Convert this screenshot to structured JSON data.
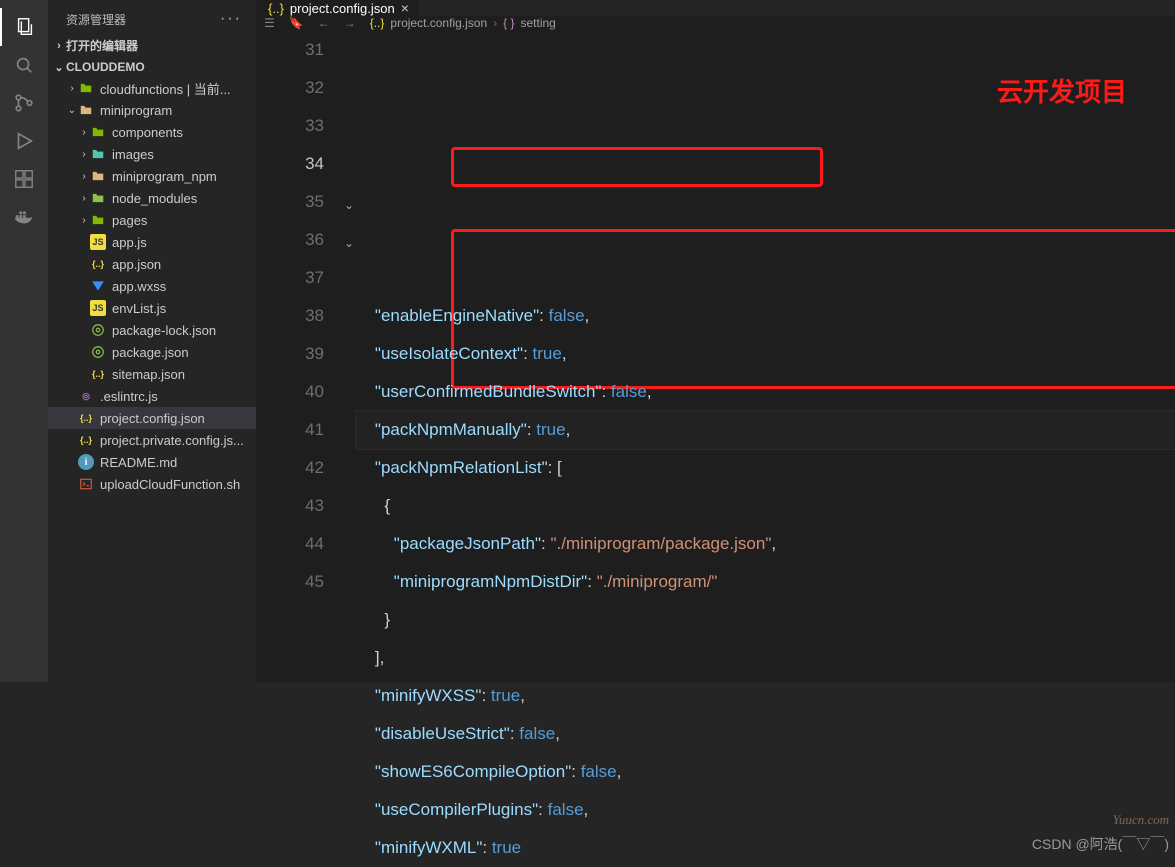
{
  "activity_bar": {
    "items": [
      "files",
      "search",
      "source-control",
      "run-debug",
      "extensions",
      "docker"
    ]
  },
  "sidebar": {
    "title": "资源管理器",
    "sections": {
      "open_editors": "打开的编辑器",
      "project": "CLOUDDEMO"
    },
    "tree": [
      {
        "type": "folder",
        "label": "cloudfunctions | 当前...",
        "indent": 1,
        "expanded": false,
        "icon": "folder-green"
      },
      {
        "type": "folder",
        "label": "miniprogram",
        "indent": 1,
        "expanded": true,
        "icon": "folder"
      },
      {
        "type": "folder",
        "label": "components",
        "indent": 2,
        "expanded": false,
        "icon": "folder-green"
      },
      {
        "type": "folder",
        "label": "images",
        "indent": 2,
        "expanded": false,
        "icon": "folder-teal"
      },
      {
        "type": "folder",
        "label": "miniprogram_npm",
        "indent": 2,
        "expanded": false,
        "icon": "folder"
      },
      {
        "type": "folder",
        "label": "node_modules",
        "indent": 2,
        "expanded": false,
        "icon": "nm"
      },
      {
        "type": "folder",
        "label": "pages",
        "indent": 2,
        "expanded": false,
        "icon": "folder-green"
      },
      {
        "type": "file",
        "label": "app.js",
        "indent": 2,
        "icon": "js"
      },
      {
        "type": "file",
        "label": "app.json",
        "indent": 2,
        "icon": "json"
      },
      {
        "type": "file",
        "label": "app.wxss",
        "indent": 2,
        "icon": "wxss"
      },
      {
        "type": "file",
        "label": "envList.js",
        "indent": 2,
        "icon": "js"
      },
      {
        "type": "file",
        "label": "package-lock.json",
        "indent": 2,
        "icon": "nm"
      },
      {
        "type": "file",
        "label": "package.json",
        "indent": 2,
        "icon": "nm"
      },
      {
        "type": "file",
        "label": "sitemap.json",
        "indent": 2,
        "icon": "json"
      },
      {
        "type": "file",
        "label": ".eslintrc.js",
        "indent": 1,
        "icon": "target"
      },
      {
        "type": "file",
        "label": "project.config.json",
        "indent": 1,
        "icon": "json",
        "selected": true
      },
      {
        "type": "file",
        "label": "project.private.config.js...",
        "indent": 1,
        "icon": "json"
      },
      {
        "type": "file",
        "label": "README.md",
        "indent": 1,
        "icon": "readme"
      },
      {
        "type": "file",
        "label": "uploadCloudFunction.sh",
        "indent": 1,
        "icon": "sh"
      }
    ]
  },
  "tab": {
    "label": "project.config.json"
  },
  "breadcrumb": {
    "file": "project.config.json",
    "symbol": "setting"
  },
  "editor": {
    "line_start": 31,
    "current_line": 34,
    "lines": [
      {
        "num": 31,
        "indent": 2,
        "key": "enableEngineNative",
        "val": "false",
        "comma": true
      },
      {
        "num": 32,
        "indent": 2,
        "key": "useIsolateContext",
        "val": "true",
        "comma": true
      },
      {
        "num": 33,
        "indent": 2,
        "key": "userConfirmedBundleSwitch",
        "val": "false",
        "comma": true
      },
      {
        "num": 34,
        "indent": 2,
        "key": "packNpmManually",
        "val": "true",
        "comma": true
      },
      {
        "num": 35,
        "indent": 2,
        "key": "packNpmRelationList",
        "open": "["
      },
      {
        "num": 36,
        "indent": 3,
        "open": "{"
      },
      {
        "num": 37,
        "indent": 4,
        "key": "packageJsonPath",
        "strval": "./miniprogram/package.json",
        "comma": true
      },
      {
        "num": 38,
        "indent": 4,
        "key": "miniprogramNpmDistDir",
        "strval": "./miniprogram/"
      },
      {
        "num": 39,
        "indent": 3,
        "close": "}"
      },
      {
        "num": 40,
        "indent": 2,
        "close": "]",
        "comma": true
      },
      {
        "num": 41,
        "indent": 2,
        "key": "minifyWXSS",
        "val": "true",
        "comma": true
      },
      {
        "num": 42,
        "indent": 2,
        "key": "disableUseStrict",
        "val": "false",
        "comma": true
      },
      {
        "num": 43,
        "indent": 2,
        "key": "showES6CompileOption",
        "val": "false",
        "comma": true
      },
      {
        "num": 44,
        "indent": 2,
        "key": "useCompilerPlugins",
        "val": "false",
        "comma": true
      },
      {
        "num": 45,
        "indent": 2,
        "key": "minifyWXML",
        "val": "true"
      }
    ]
  },
  "annotation": "云开发项目",
  "watermarks": {
    "w1": "Yuucn.com",
    "w2": "CSDN @阿浩(￣▽￣)"
  }
}
